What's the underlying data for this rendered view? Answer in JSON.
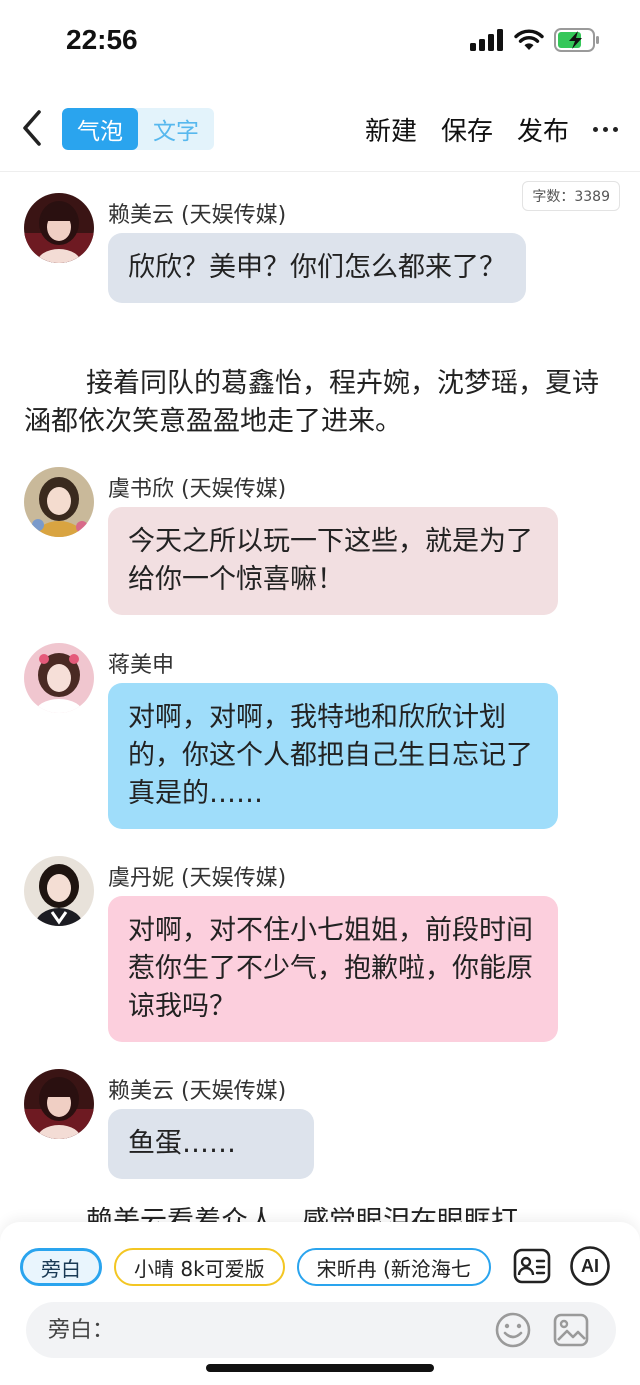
{
  "status_bar": {
    "time": "22:56"
  },
  "toolbar": {
    "segments": [
      "气泡",
      "文字"
    ],
    "actions": [
      "新建",
      "保存",
      "发布"
    ]
  },
  "word_count": "字数：3389",
  "messages": [
    {
      "type": "bubble",
      "name": "赖美云 (天娱传媒)",
      "text": "欣欣？美申？你们怎么都来了？",
      "bubble_color": "#dde3ec",
      "avatar": "avatar-lai"
    },
    {
      "type": "narration",
      "text": "接着同队的葛鑫怡，程卉婉，沈梦瑶，夏诗涵都依次笑意盈盈地走了进来。"
    },
    {
      "type": "bubble",
      "name": "虞书欣 (天娱传媒)",
      "text": "今天之所以玩一下这些，就是为了给你一个惊喜嘛！",
      "bubble_color": "#f2dfe1",
      "avatar": "avatar-yu"
    },
    {
      "type": "bubble",
      "name": "蒋美申",
      "text": "对啊，对啊，我特地和欣欣计划的，你这个人都把自己生日忘记了 真是的……",
      "bubble_color": "#9fddfa",
      "avatar": "avatar-jiang"
    },
    {
      "type": "bubble",
      "name": "虞丹妮 (天娱传媒)",
      "text": "对啊，对不住小七姐姐，前段时间惹你生了不少气，抱歉啦，你能原谅我吗？",
      "bubble_color": "#fccfdd",
      "avatar": "avatar-yudn"
    },
    {
      "type": "bubble",
      "name": "赖美云 (天娱传媒)",
      "text": "鱼蛋……",
      "bubble_color": "#dde3ec",
      "avatar": "avatar-lai"
    },
    {
      "type": "narration",
      "text": "赖美云看着众人，感觉眼泪在眼眶打"
    }
  ],
  "bottom": {
    "chips": [
      "旁白",
      "小晴 8k可爱版",
      "宋昕冉 (新沧海七"
    ],
    "ai_label": "AI",
    "input_placeholder": "旁白："
  }
}
